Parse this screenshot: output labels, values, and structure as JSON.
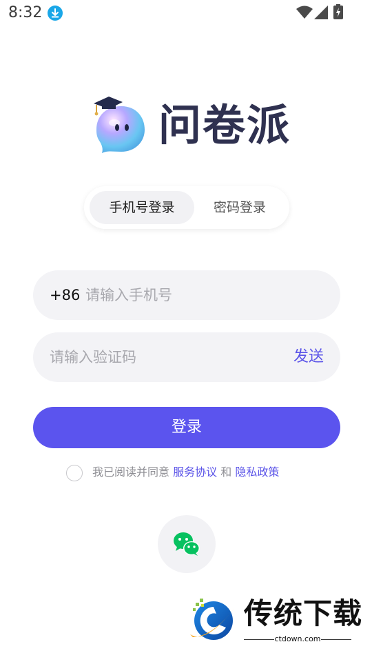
{
  "status_bar": {
    "time": "8:32"
  },
  "app": {
    "name": "问卷派"
  },
  "tabs": [
    {
      "label": "手机号登录",
      "active": true
    },
    {
      "label": "密码登录",
      "active": false
    }
  ],
  "phone": {
    "country_code": "+86",
    "placeholder": "请输入手机号",
    "value": ""
  },
  "code": {
    "placeholder": "请输入验证码",
    "value": "",
    "send_label": "发送"
  },
  "login": {
    "label": "登录"
  },
  "agreement": {
    "prefix": "我已阅读并同意",
    "terms": "服务协议",
    "and": "和",
    "privacy": "隐私政策",
    "checked": false
  },
  "social": {
    "icon": "wechat-icon"
  },
  "watermark": {
    "title": "传统下载",
    "url": "ctdown.com"
  },
  "colors": {
    "accent": "#5b54ee",
    "link": "#5b54e8",
    "input_bg": "#f3f3f6",
    "brand_text": "#2f3150",
    "wechat_green": "#07c160"
  }
}
